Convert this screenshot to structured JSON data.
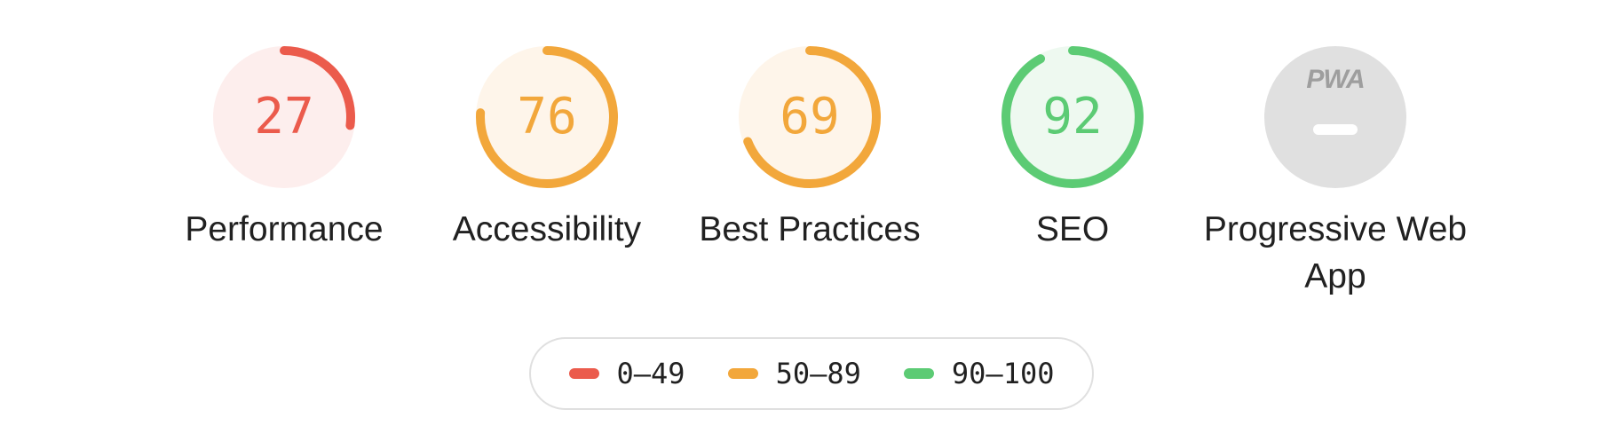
{
  "colors": {
    "fail": "#eb5b4c",
    "fail_bg": "#fdeeed",
    "average": "#f2a73b",
    "average_bg": "#fef5ea",
    "pass": "#5ccb74",
    "pass_bg": "#eef9f0",
    "na": "#9e9e9e",
    "na_bg": "#e0e0e0",
    "text": "#212121",
    "legend_border": "#e0e0e0"
  },
  "gauges": [
    {
      "id": "performance",
      "label": "Performance",
      "score": 27,
      "score_text": "27",
      "rating": "fail"
    },
    {
      "id": "accessibility",
      "label": "Accessibility",
      "score": 76,
      "score_text": "76",
      "rating": "average"
    },
    {
      "id": "best-practices",
      "label": "Best Practices",
      "score": 69,
      "score_text": "69",
      "rating": "average"
    },
    {
      "id": "seo",
      "label": "SEO",
      "score": 92,
      "score_text": "92",
      "rating": "pass"
    },
    {
      "id": "pwa",
      "label": "Progressive Web App",
      "badge_text": "PWA",
      "icon": "pwa-icon",
      "rating": "na"
    }
  ],
  "legend": [
    {
      "range": "0–49",
      "rating": "fail"
    },
    {
      "range": "50–89",
      "rating": "average"
    },
    {
      "range": "90–100",
      "rating": "pass"
    }
  ]
}
